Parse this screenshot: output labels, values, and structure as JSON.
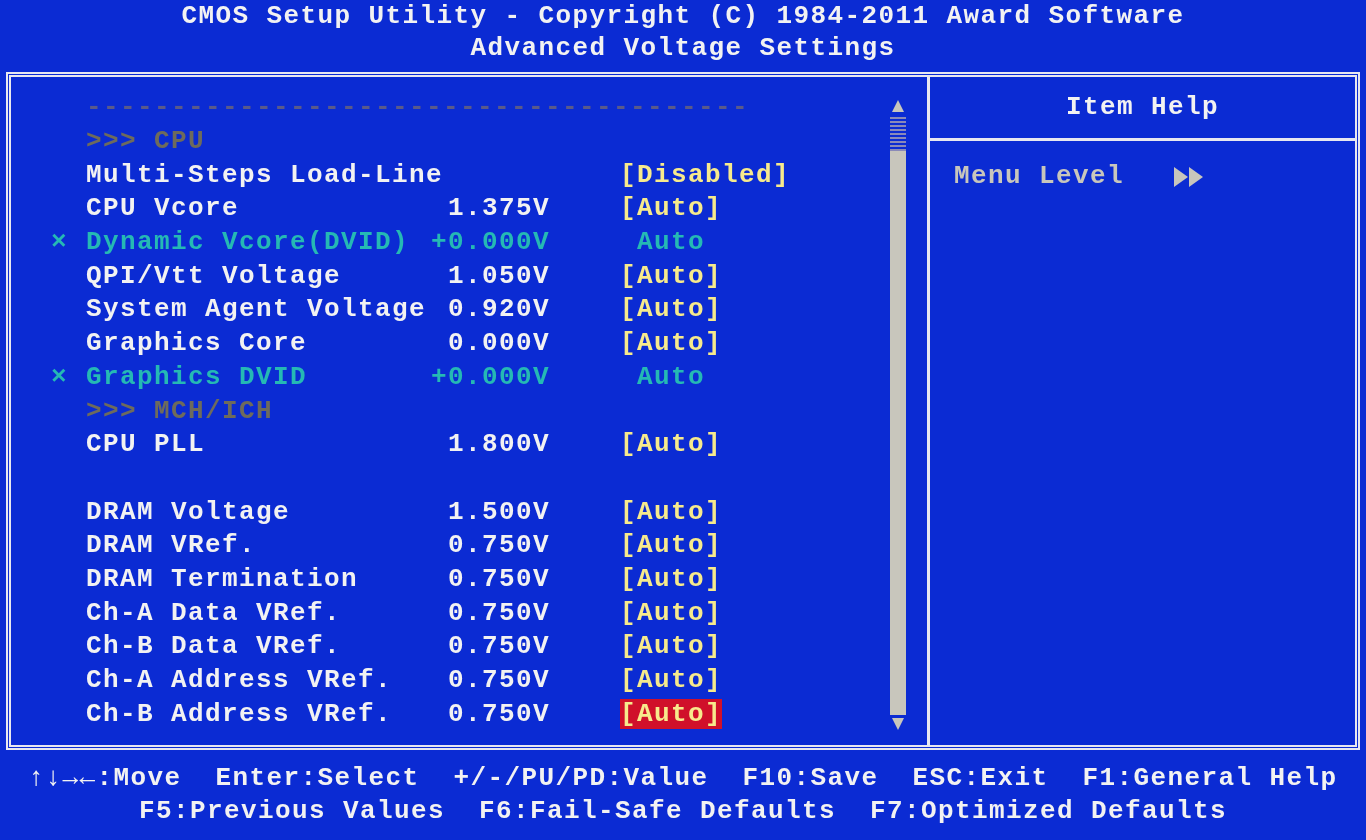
{
  "title": [
    "CMOS Setup Utility - Copyright (C) 1984-2011 Award Software",
    "Advanced Voltage Settings"
  ],
  "rows": [
    {
      "kind": "separator",
      "text": "---------------------------------------"
    },
    {
      "kind": "header",
      "text": ">>> CPU"
    },
    {
      "kind": "setting",
      "name": "Multi-Steps Load-Line",
      "voltage": "",
      "value": "[Disabled]",
      "disabled": false,
      "selected": false
    },
    {
      "kind": "setting",
      "name": "CPU Vcore",
      "voltage": "1.375V",
      "value": "[Auto]",
      "disabled": false,
      "selected": false
    },
    {
      "kind": "setting",
      "marker": "×",
      "name": "Dynamic Vcore(DVID)",
      "voltage": "+0.000V",
      "value": "Auto",
      "disabled": true,
      "selected": false
    },
    {
      "kind": "setting",
      "name": "QPI/Vtt Voltage",
      "voltage": "1.050V",
      "value": "[Auto]",
      "disabled": false,
      "selected": false
    },
    {
      "kind": "setting",
      "name": "System Agent Voltage",
      "voltage": "0.920V",
      "value": "[Auto]",
      "disabled": false,
      "selected": false
    },
    {
      "kind": "setting",
      "name": "Graphics Core",
      "voltage": "0.000V",
      "value": "[Auto]",
      "disabled": false,
      "selected": false
    },
    {
      "kind": "setting",
      "marker": "×",
      "name": "Graphics DVID",
      "voltage": "+0.000V",
      "value": "Auto",
      "disabled": true,
      "selected": false
    },
    {
      "kind": "header",
      "text": ">>> MCH/ICH"
    },
    {
      "kind": "setting",
      "name": "CPU PLL",
      "voltage": "1.800V",
      "value": "[Auto]",
      "disabled": false,
      "selected": false
    },
    {
      "kind": "blank"
    },
    {
      "kind": "setting",
      "name": "DRAM Voltage",
      "voltage": "1.500V",
      "value": "[Auto]",
      "disabled": false,
      "selected": false
    },
    {
      "kind": "setting",
      "name": "DRAM VRef.",
      "voltage": "0.750V",
      "value": "[Auto]",
      "disabled": false,
      "selected": false
    },
    {
      "kind": "setting",
      "name": "DRAM Termination",
      "voltage": "0.750V",
      "value": "[Auto]",
      "disabled": false,
      "selected": false
    },
    {
      "kind": "setting",
      "name": "Ch-A Data VRef.",
      "voltage": "0.750V",
      "value": "[Auto]",
      "disabled": false,
      "selected": false
    },
    {
      "kind": "setting",
      "name": "Ch-B Data VRef.",
      "voltage": "0.750V",
      "value": "[Auto]",
      "disabled": false,
      "selected": false
    },
    {
      "kind": "setting",
      "name": "Ch-A Address VRef.",
      "voltage": "0.750V",
      "value": "[Auto]",
      "disabled": false,
      "selected": false
    },
    {
      "kind": "setting",
      "name": "Ch-B Address VRef.",
      "voltage": "0.750V",
      "value": "[Auto]",
      "disabled": false,
      "selected": true
    }
  ],
  "help": {
    "title": "Item Help",
    "menu_level_label": "Menu Level"
  },
  "footer": [
    [
      "↑↓→←:Move",
      "Enter:Select",
      "+/-/PU/PD:Value",
      "F10:Save",
      "ESC:Exit",
      "F1:General Help"
    ],
    [
      "F5:Previous Values",
      "F6:Fail-Safe Defaults",
      "F7:Optimized Defaults"
    ]
  ]
}
